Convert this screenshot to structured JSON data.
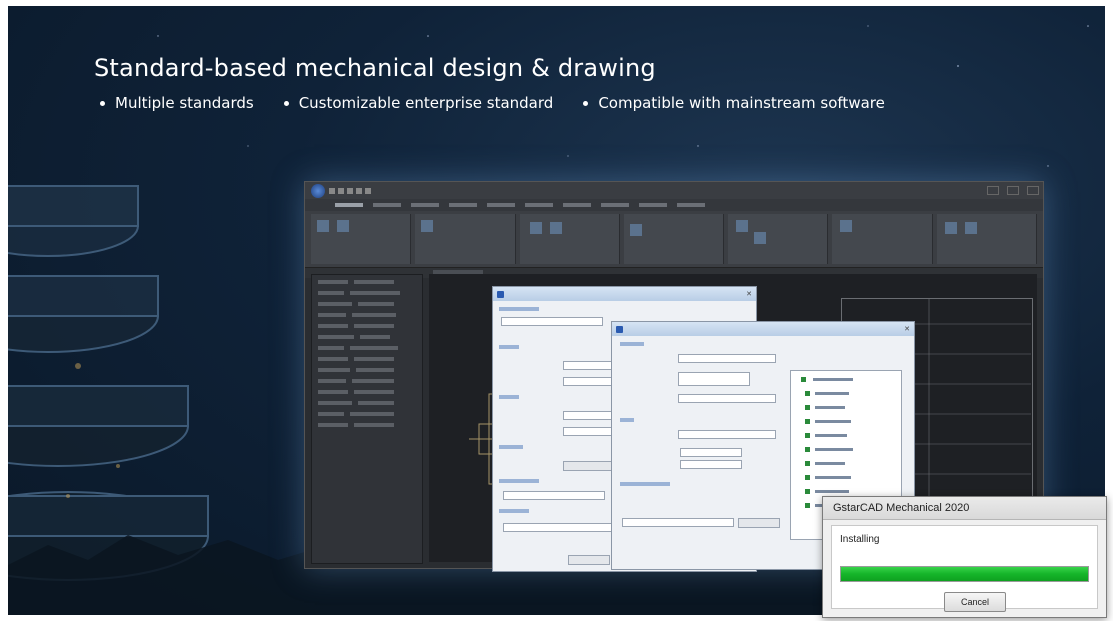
{
  "banner": {
    "heading": "Standard-based mechanical design & drawing",
    "bullets": [
      "Multiple standards",
      "Customizable enterprise standard",
      "Compatible with mainstream software"
    ]
  },
  "installer": {
    "title": "GstarCAD Mechanical 2020",
    "status": "Installing",
    "progress_fraction": 1.0,
    "progress_color": "#16b52a",
    "cancel_label": "Cancel"
  },
  "colors": {
    "background": "#0f2238",
    "cad_dark": "#2a2d31",
    "dialog_bg": "#eef1f5"
  }
}
